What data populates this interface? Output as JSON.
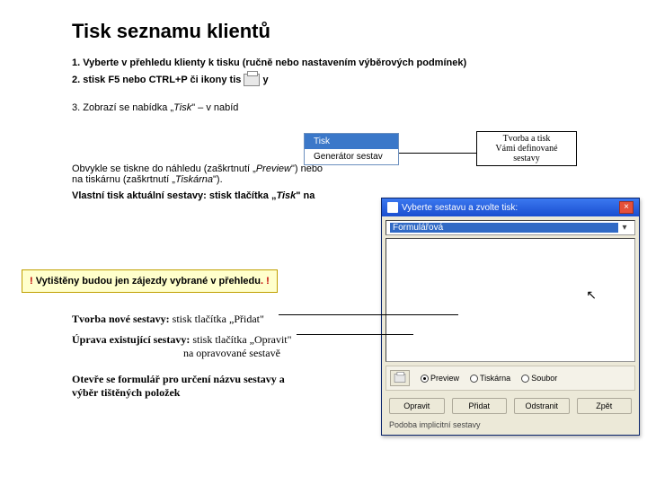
{
  "title": "Tisk seznamu klientů",
  "steps": {
    "s1": "1. Vyberte v přehledu klienty k tisku (ručně nebo nastavením výběrových podmínek)",
    "s2a": "2. stisk F5 nebo CTRL+P či ikony tis",
    "s2b": "y",
    "s3a": "3. Zobrazí se nabídka „",
    "s3b": "Tisk",
    "s3c": "\" – v nabíd"
  },
  "menu_popup": {
    "item1": "Tisk",
    "item2": "Generátor sestav"
  },
  "callout": {
    "l1": "Tvorba a tisk",
    "l2": "Vámi definované",
    "l3": "sestavy"
  },
  "para1a": "Obvykle se tiskne do náhledu (zaškrtnutí „",
  "para1b": "Preview",
  "para1c": "\") nebo",
  "para1d": "na tiskárnu (zaškrtnutí „",
  "para1e": "Tiskárna",
  "para1f": "\").",
  "para2a": "Vlastní tisk aktuální sestavy: stisk tlačítka „",
  "para2b": "Tisk",
  "para2c": "\" na",
  "yellow_left": "! ",
  "yellow_mid": "Vytištěny budou jen zájezdy vybrané v přehledu",
  "yellow_right": ". !",
  "serif_block": {
    "l1a": "Tvorba nové sestavy:",
    "l1b": " stisk tlačítka „Přidat\"",
    "l2a": "Úprava existující sestavy:",
    "l2b": " stisk tlačítka „Opravit\"",
    "l2c": "na opravované sestavě",
    "l3a": "Otevře se formulář pro určení názvu sestavy a",
    "l3b": "výběr tištěných položek"
  },
  "dialog": {
    "title": "Vyberte sestavu a zvolte tisk:",
    "close": "×",
    "combo_value": "Formulářová",
    "radio1": "Preview",
    "radio2": "Tiskárna",
    "radio3": "Soubor",
    "btn1": "Opravit",
    "btn2": "Přidat",
    "btn3": "Odstranit",
    "btn4": "Zpět",
    "footer": "Podoba implicitní sestavy"
  }
}
